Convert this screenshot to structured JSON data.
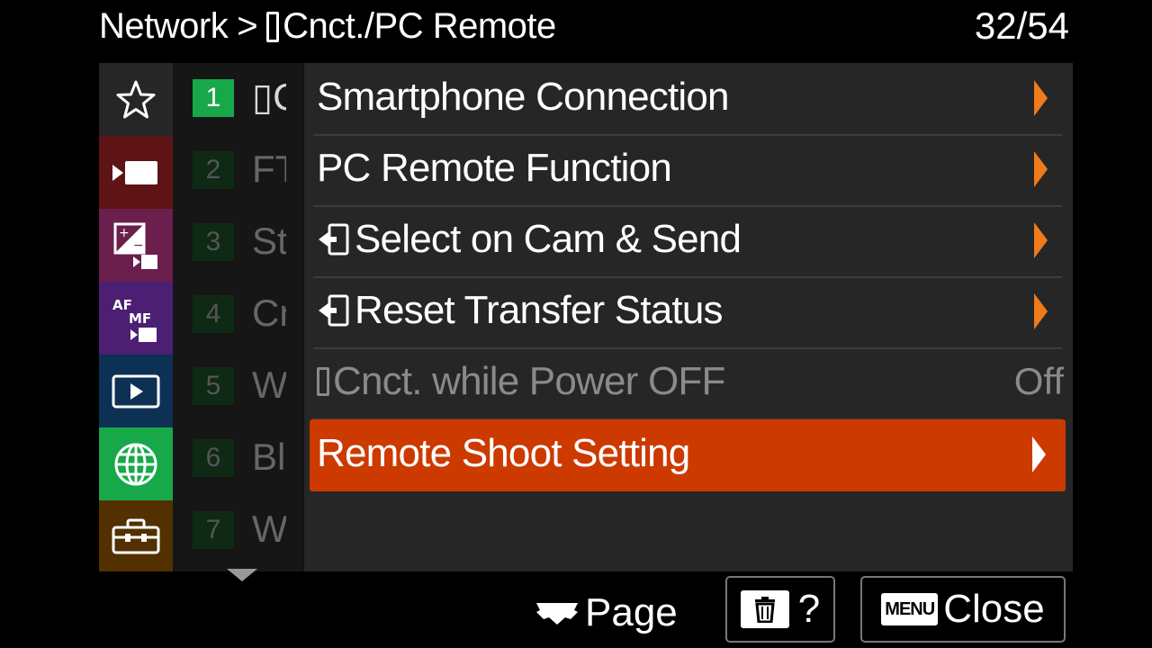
{
  "header": {
    "crumb_root": "Network",
    "crumb_sep": ">",
    "crumb_current": "Cnct./PC Remote",
    "page_count": "32/54"
  },
  "tabs": [
    {
      "name": "tab-favorites",
      "icon": "star-icon",
      "color": "#262626"
    },
    {
      "name": "tab-shooting",
      "icon": "movie-camera-icon",
      "color": "#5e1414"
    },
    {
      "name": "tab-exposure-color",
      "icon": "exposure-icon",
      "color": "#6a1f4d"
    },
    {
      "name": "tab-focus",
      "icon": "af-mf-icon",
      "color": "#4c1f73"
    },
    {
      "name": "tab-playback",
      "icon": "playback-icon",
      "color": "#0c3154"
    },
    {
      "name": "tab-network",
      "icon": "globe-icon",
      "color": "#17a84a"
    },
    {
      "name": "tab-setup",
      "icon": "toolbox-icon",
      "color": "#523000"
    }
  ],
  "subpages": [
    {
      "num": "1",
      "abbr": "▯C",
      "active": true
    },
    {
      "num": "2",
      "abbr": "FT",
      "active": false
    },
    {
      "num": "3",
      "abbr": "St",
      "active": false
    },
    {
      "num": "4",
      "abbr": "Cr",
      "active": false
    },
    {
      "num": "5",
      "abbr": "W",
      "active": false
    },
    {
      "num": "6",
      "abbr": "Bl",
      "active": false
    },
    {
      "num": "7",
      "abbr": "W",
      "active": false
    }
  ],
  "menu": {
    "items": [
      {
        "label": "Smartphone Connection"
      },
      {
        "label": "PC Remote Function"
      },
      {
        "label": "Select on Cam & Send"
      },
      {
        "label": "Reset Transfer Status"
      },
      {
        "label": "Cnct. while Power OFF",
        "value": "Off"
      },
      {
        "label": "Remote Shoot Setting"
      }
    ],
    "accent_color": "#cc3a00",
    "arrow_color": "#f07a1a"
  },
  "footer": {
    "page_label": "Page",
    "help_label": "?",
    "menu_key": "MENU",
    "close_label": "Close"
  }
}
